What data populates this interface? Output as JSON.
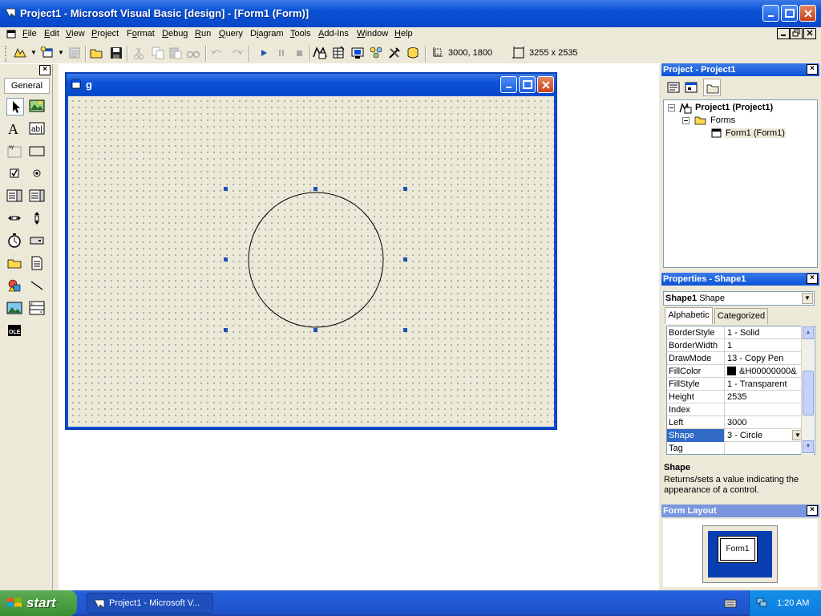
{
  "window": {
    "title": "Project1 - Microsoft Visual Basic [design] - [Form1 (Form)]"
  },
  "menu": {
    "items": [
      {
        "label": "File",
        "key": "F",
        "rest": "ile"
      },
      {
        "label": "Edit",
        "key": "E",
        "rest": "dit"
      },
      {
        "label": "View",
        "key": "V",
        "rest": "iew"
      },
      {
        "label": "Project",
        "key": "P",
        "rest": "roject"
      },
      {
        "label": "Format",
        "key": "o",
        "pre": "F",
        "rest": "rmat"
      },
      {
        "label": "Debug",
        "key": "D",
        "rest": "ebug"
      },
      {
        "label": "Run",
        "key": "R",
        "rest": "un"
      },
      {
        "label": "Query",
        "key": "Q",
        "rest": "uery"
      },
      {
        "label": "Diagram",
        "key": "i",
        "pre": "D",
        "rest": "agram"
      },
      {
        "label": "Tools",
        "key": "T",
        "rest": "ools"
      },
      {
        "label": "Add-Ins",
        "key": "A",
        "rest": "dd-Ins"
      },
      {
        "label": "Window",
        "key": "W",
        "rest": "indow"
      },
      {
        "label": "Help",
        "key": "H",
        "rest": "elp"
      }
    ]
  },
  "toolbar": {
    "position": "3000, 1800",
    "size": "3255 x 2535"
  },
  "toolbox": {
    "tab_label": "General",
    "icons": [
      "pointer-icon",
      "picturebox-icon",
      "label-icon",
      "textbox-icon",
      "frame-icon",
      "commandbutton-icon",
      "checkbox-icon",
      "optionbutton-icon",
      "combobox-icon",
      "listbox-icon",
      "hscrollbar-icon",
      "vscrollbar-icon",
      "timer-icon",
      "drivelistbox-icon",
      "dirlistbox-icon",
      "filelistbox-icon",
      "shape-icon",
      "line-icon",
      "image-icon",
      "data-icon",
      "ole-icon"
    ]
  },
  "form": {
    "title": "g"
  },
  "project_panel": {
    "title": "Project - Project1",
    "tree": {
      "root": "Project1 (Project1)",
      "folder": "Forms",
      "item": "Form1 (Form1)"
    }
  },
  "properties_panel": {
    "title": "Properties - Shape1",
    "object_bold": "Shape1",
    "object_type": "Shape",
    "tabs": {
      "alphabetic": "Alphabetic",
      "categorized": "Categorized"
    },
    "rows": [
      {
        "name": "BorderStyle",
        "value": "1 - Solid"
      },
      {
        "name": "BorderWidth",
        "value": "1"
      },
      {
        "name": "DrawMode",
        "value": "13 - Copy Pen"
      },
      {
        "name": "FillColor",
        "value": "&H00000000&"
      },
      {
        "name": "FillStyle",
        "value": "1 - Transparent"
      },
      {
        "name": "Height",
        "value": "2535"
      },
      {
        "name": "Index",
        "value": ""
      },
      {
        "name": "Left",
        "value": "3000"
      },
      {
        "name": "Shape",
        "value": "3 - Circle"
      },
      {
        "name": "Tag",
        "value": ""
      }
    ],
    "selected_row": "Shape",
    "description_name": "Shape",
    "description_text": "Returns/sets a value indicating the appearance of a control."
  },
  "layout_panel": {
    "title": "Form Layout",
    "form_label": "Form1"
  },
  "taskbar": {
    "start_label": "start",
    "task_label": "Project1 - Microsoft V...",
    "clock": "1:20 AM"
  },
  "colors": {
    "xp_blue": "#0a52d6",
    "selection": "#316ac5",
    "start_green": "#3c8f33",
    "handle": "#1f4fb5"
  }
}
